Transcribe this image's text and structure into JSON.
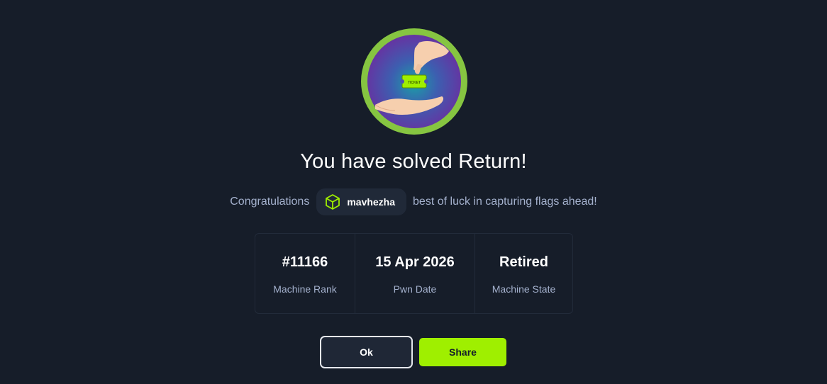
{
  "badge": {
    "icon": "ticket-handover-icon",
    "ticket_text": "TICKET",
    "colors": {
      "ring": "#86c541",
      "inner": "#6a2fa0",
      "ticket": "#9fef00"
    }
  },
  "title": "You have solved Return!",
  "congrats": {
    "prefix": "Congratulations",
    "username": "mavhezha",
    "suffix": "best of luck in capturing flags ahead!",
    "user_icon": "cube-icon"
  },
  "stats": [
    {
      "value": "#11166",
      "label": "Machine Rank"
    },
    {
      "value": "15 Apr 2026",
      "label": "Pwn Date"
    },
    {
      "value": "Retired",
      "label": "Machine State"
    }
  ],
  "buttons": {
    "ok_label": "Ok",
    "share_label": "Share"
  },
  "colors": {
    "background": "#161d29",
    "accent": "#9fef00",
    "muted_text": "#a4b1cd"
  }
}
